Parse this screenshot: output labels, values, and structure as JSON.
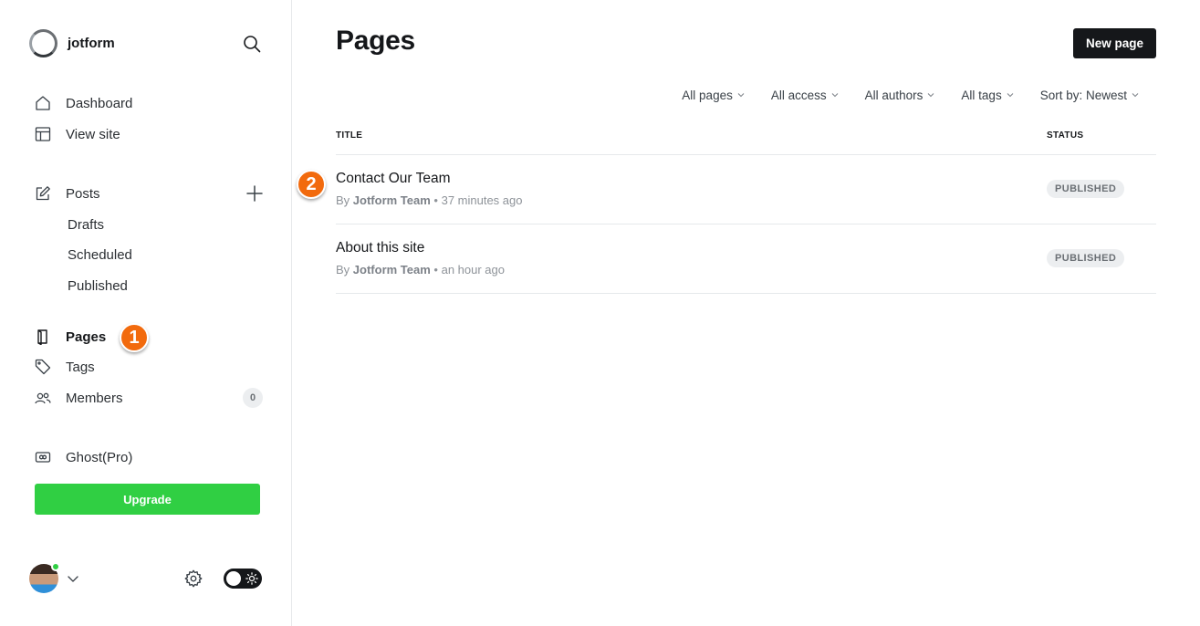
{
  "brand": {
    "name": "jotform"
  },
  "sidebar": {
    "nav": [
      {
        "label": "Dashboard",
        "icon": "home-icon"
      },
      {
        "label": "View site",
        "icon": "layout-icon"
      }
    ],
    "posts": {
      "label": "Posts",
      "icon": "edit-icon"
    },
    "post_subitems": [
      "Drafts",
      "Scheduled",
      "Published"
    ],
    "pages": {
      "label": "Pages",
      "icon": "page-icon"
    },
    "tags": {
      "label": "Tags",
      "icon": "tag-icon"
    },
    "members": {
      "label": "Members",
      "icon": "members-icon",
      "count": "0"
    },
    "ghost_pro": {
      "label": "Ghost(Pro)",
      "icon": "ghost-pro-icon"
    },
    "upgrade_label": "Upgrade"
  },
  "main": {
    "title": "Pages",
    "new_page_label": "New page",
    "filters": [
      "All pages",
      "All access",
      "All authors",
      "All tags",
      "Sort by: Newest"
    ],
    "columns": {
      "title": "TITLE",
      "status": "STATUS"
    },
    "rows": [
      {
        "title": "Contact Our Team",
        "by": "By",
        "author": "Jotform Team",
        "time": "• 37 minutes ago",
        "status": "PUBLISHED"
      },
      {
        "title": "About this site",
        "by": "By",
        "author": "Jotform Team",
        "time": "• an hour ago",
        "status": "PUBLISHED"
      }
    ]
  },
  "steps": {
    "one": "1",
    "two": "2"
  },
  "colors": {
    "accent_green": "#30cf43",
    "step_orange": "#f26a0d",
    "dark": "#15171a"
  }
}
